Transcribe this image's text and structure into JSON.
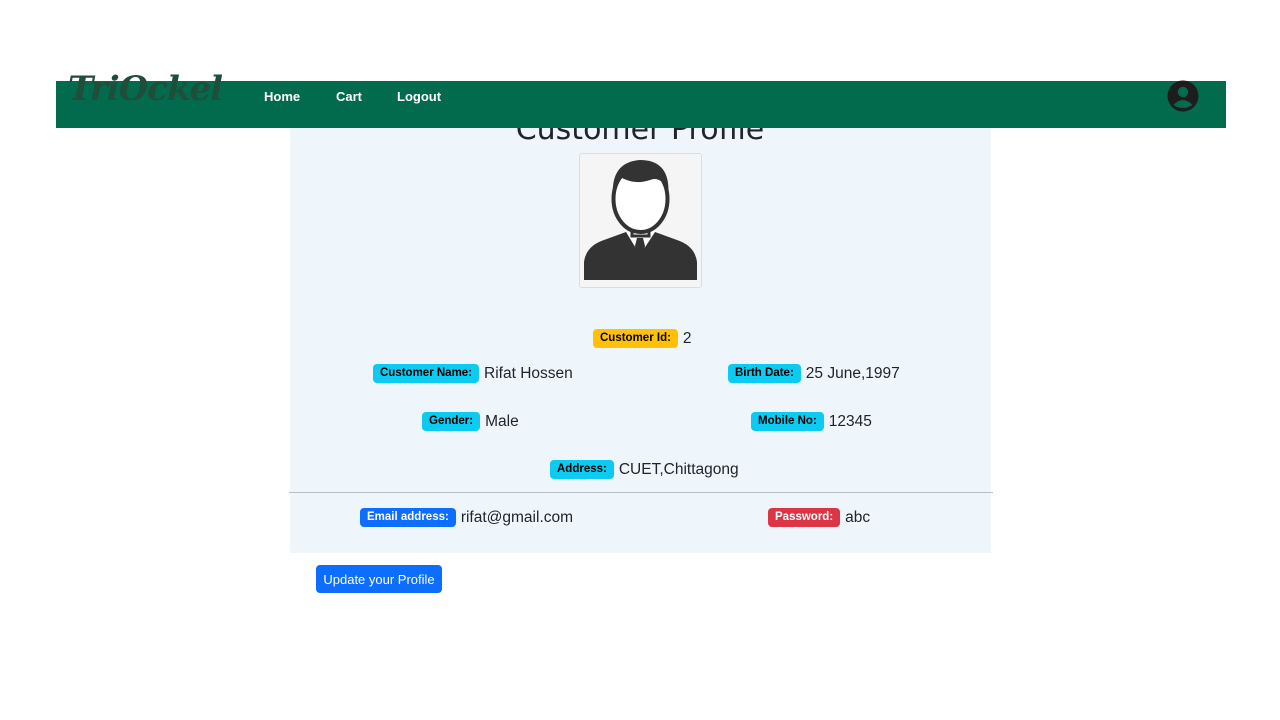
{
  "page": {
    "title": "Customer Profile"
  },
  "navbar": {
    "brand": "TriOckel",
    "links": {
      "home": "Home",
      "cart": "Cart",
      "logout": "Logout"
    },
    "user_icon": "user-circle-icon",
    "background_color": "#036b4d"
  },
  "profile": {
    "avatar_icon": "businessman-avatar-icon",
    "fields": {
      "customer_id": {
        "label": "Customer Id:",
        "value": "2"
      },
      "customer_name": {
        "label": "Customer Name:",
        "value": "Rifat Hossen"
      },
      "birth_date": {
        "label": "Birth Date:",
        "value": "25 June,1997"
      },
      "gender": {
        "label": "Gender:",
        "value": "Male"
      },
      "mobile_no": {
        "label": "Mobile No:",
        "value": "12345"
      },
      "address": {
        "label": "Address:",
        "value": "CUET,Chittagong"
      },
      "email": {
        "label": "Email address:",
        "value": "rifat@gmail.com"
      },
      "password": {
        "label": "Password:",
        "value": "abc"
      }
    }
  },
  "actions": {
    "update_button": "Update your Profile"
  },
  "colors": {
    "warning_badge": "#ffc107",
    "info_badge": "#0dcaf0",
    "primary_badge": "#0d6efd",
    "danger_badge": "#dc3545",
    "card_background": "#eef6fc"
  }
}
